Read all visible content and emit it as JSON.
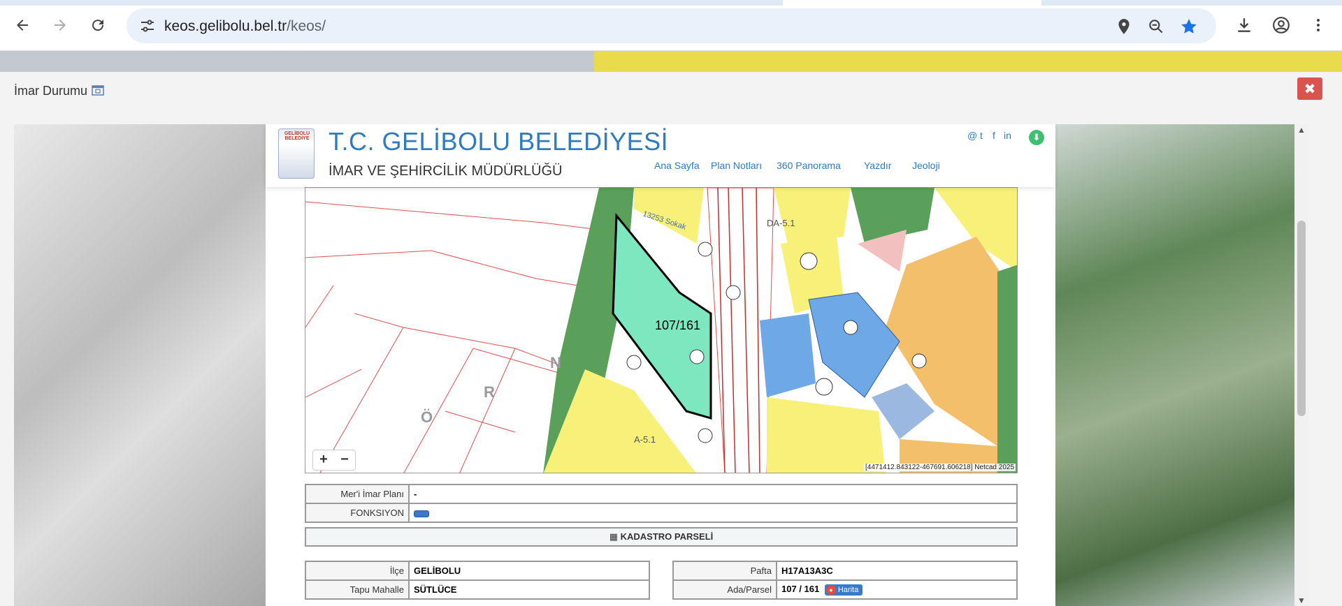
{
  "browser": {
    "url_host": "keos.gelibolu.bel.tr",
    "url_path": "/keos/",
    "icons": [
      "back-icon",
      "forward-icon",
      "reload-icon",
      "site-settings-icon",
      "location-icon",
      "zoom-out-icon",
      "bookmark-star-icon",
      "download-icon",
      "account-icon",
      "more-icon"
    ]
  },
  "modal": {
    "title": "İmar Durumu",
    "close_label": "✖"
  },
  "header": {
    "logo_text": "GELİBOLU BELEDİYE",
    "title": "T.C. GELİBOLU BELEDİYESİ",
    "subtitle": "İMAR VE ŞEHİRCİLİK MÜDÜRLÜĞÜ",
    "social": [
      "@",
      "t",
      "f",
      "in"
    ],
    "nav": [
      "Ana Sayfa",
      "Plan Notları",
      "360 Panorama",
      "Yazdır",
      "Jeoloji"
    ]
  },
  "map": {
    "parcel_label": "107/161",
    "street_label": "13253 Sokak",
    "letters": [
      "Ö",
      "R",
      "N"
    ],
    "zone_labels": [
      "A-5.1",
      "DA-5.1"
    ],
    "zoom_in": "+",
    "zoom_out": "−",
    "coords": "[4471412.843122-467691.606218] Netcad 2025",
    "colors": {
      "green_parcel": "#7de8c0",
      "yellow_zone": "#f7f17a",
      "orange_zone": "#f3bf6a",
      "blue_zone": "#6fa8e6",
      "park_green": "#5aa05a",
      "line_red": "#e05050"
    }
  },
  "plan": {
    "rows": [
      {
        "label": "Mer'i İmar Planı",
        "value": "-"
      },
      {
        "label": "FONKSIYON",
        "value": ""
      }
    ]
  },
  "kadastro": {
    "title": "KADASTRO PARSELİ",
    "left": [
      {
        "label": "İlçe",
        "value": "GELİBOLU"
      },
      {
        "label": "Tapu Mahalle",
        "value": "SÜTLÜCE"
      }
    ],
    "right": [
      {
        "label": "Pafta",
        "value": "H17A13A3C"
      },
      {
        "label": "Ada/Parsel",
        "value": "107 / 161"
      }
    ],
    "harita_label": "Harita"
  }
}
